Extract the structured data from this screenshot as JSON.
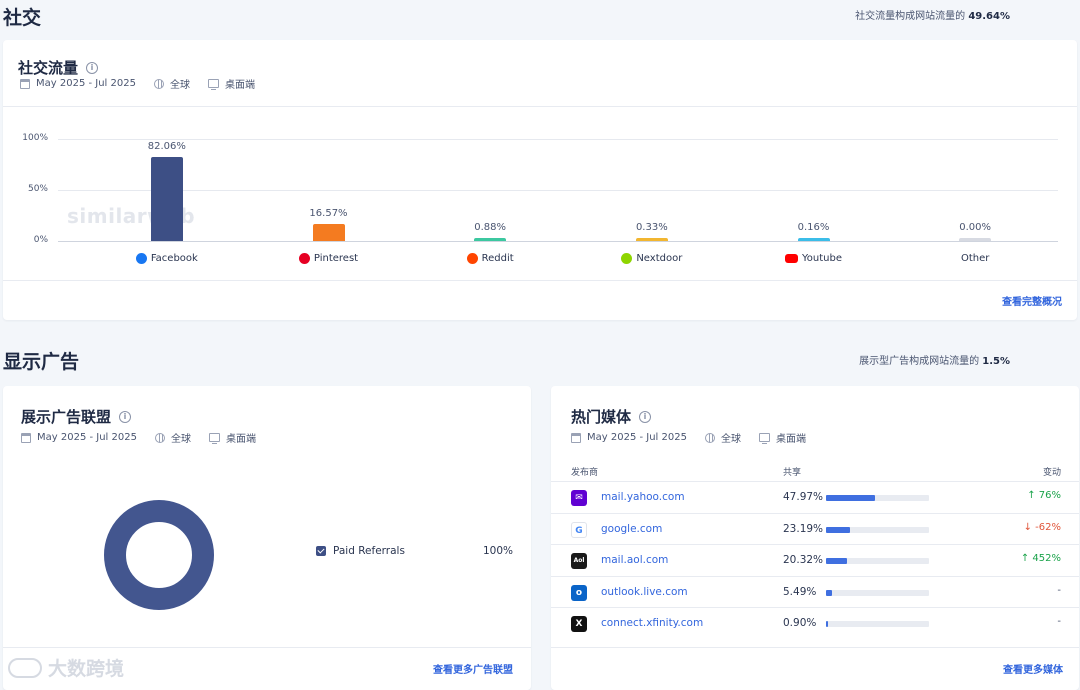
{
  "social": {
    "section_title": "社交",
    "note_prefix": "社交流量构成网站流量的",
    "note_value": "49.64%",
    "card_title": "社交流量",
    "date_range": "May 2025 - Jul 2025",
    "region": "全球",
    "device": "桌面端",
    "view_link": "查看完整概况",
    "watermark": "similarweb",
    "chart_data": {
      "type": "bar",
      "categories": [
        "Facebook",
        "Pinterest",
        "Reddit",
        "Nextdoor",
        "Youtube",
        "Other"
      ],
      "values": [
        82.06,
        16.57,
        0.88,
        0.33,
        0.16,
        0.0
      ],
      "value_labels": [
        "82.06%",
        "16.57%",
        "0.88%",
        "0.33%",
        "0.16%",
        "0.00%"
      ],
      "colors": [
        "#3d4f85",
        "#f47b20",
        "#3cc8a0",
        "#f2b630",
        "#3bbde8",
        "#d7dae2"
      ],
      "icons": [
        "facebook-icon",
        "pinterest-icon",
        "reddit-icon",
        "nextdoor-icon",
        "youtube-icon",
        ""
      ],
      "yticks": [
        "100%",
        "50%",
        "0%"
      ],
      "ylim": [
        0,
        100
      ],
      "grid": true
    }
  },
  "display": {
    "section_title": "显示广告",
    "note_prefix": "展示型广告构成网站流量的",
    "note_value": "1.5%",
    "network": {
      "card_title": "展示广告联盟",
      "date_range": "May 2025 - Jul 2025",
      "region": "全球",
      "device": "桌面端",
      "legend_label": "Paid Referrals",
      "legend_value": "100%",
      "donut_fraction": 1.0,
      "donut_color": "#43568f",
      "view_link": "查看更多广告联盟"
    },
    "media": {
      "card_title": "热门媒体",
      "date_range": "May 2025 - Jul 2025",
      "region": "全球",
      "device": "桌面端",
      "col_publisher": "发布商",
      "col_share": "共享",
      "col_change": "变动",
      "rows": [
        {
          "domain": "mail.yahoo.com",
          "share": "47.97%",
          "share_fraction": 0.4797,
          "change": "76%",
          "direction": "up",
          "icon": "yahoo-mail-icon"
        },
        {
          "domain": "google.com",
          "share": "23.19%",
          "share_fraction": 0.2319,
          "change": "-62%",
          "direction": "down",
          "icon": "google-icon"
        },
        {
          "domain": "mail.aol.com",
          "share": "20.32%",
          "share_fraction": 0.2032,
          "change": "452%",
          "direction": "up",
          "icon": "aol-icon"
        },
        {
          "domain": "outlook.live.com",
          "share": "5.49%",
          "share_fraction": 0.0549,
          "change": "-",
          "direction": "none",
          "icon": "outlook-icon"
        },
        {
          "domain": "connect.xfinity.com",
          "share": "0.90%",
          "share_fraction": 0.009,
          "change": "-",
          "direction": "none",
          "icon": "xfinity-icon"
        }
      ],
      "view_link": "查看更多媒体"
    }
  },
  "footer_watermark": "大数跨境"
}
